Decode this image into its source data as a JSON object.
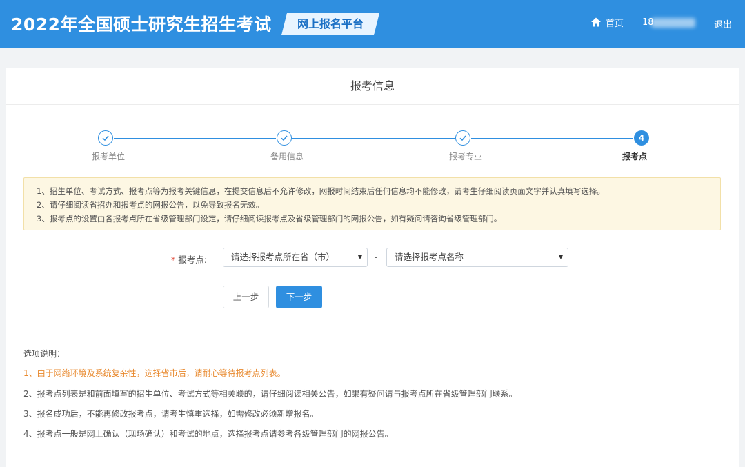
{
  "header": {
    "site_title": "2022年全国硕士研究生招生考试",
    "platform_label": "网上报名平台",
    "home_label": "首页",
    "user_id": "18",
    "logout_label": "退出",
    "brand_color": "#2f8fe0"
  },
  "panel": {
    "title": "报考信息"
  },
  "steps": [
    {
      "label": "报考单位",
      "state": "done",
      "icon": "check-icon"
    },
    {
      "label": "备用信息",
      "state": "done",
      "icon": "check-icon"
    },
    {
      "label": "报考专业",
      "state": "done",
      "icon": "check-icon"
    },
    {
      "label": "报考点",
      "state": "active",
      "number": "4"
    }
  ],
  "notice": {
    "lines": [
      "1、招生单位、考试方式、报考点等为报考关键信息，在提交信息后不允许修改，网报时间结束后任何信息均不能修改，请考生仔细阅读页面文字并认真填写选择。",
      "2、请仔细阅读省招办和报考点的网报公告，以免导致报名无效。",
      "3、报考点的设置由各报考点所在省级管理部门设定，请仔细阅读报考点及省级管理部门的网报公告，如有疑问请咨询省级管理部门。"
    ]
  },
  "form": {
    "required_mark": "*",
    "label": "报考点:",
    "province_select": "请选择报考点所在省（市）",
    "separator": "-",
    "site_select": "请选择报考点名称"
  },
  "buttons": {
    "prev": "上一步",
    "next": "下一步"
  },
  "description": {
    "title": "选项说明：",
    "lines": [
      "1、由于网络环境及系统复杂性，选择省市后，请耐心等待报考点列表。",
      "2、报考点列表是和前面填写的招生单位、考试方式等相关联的，请仔细阅读相关公告，如果有疑问请与报考点所在省级管理部门联系。",
      "3、报名成功后，不能再修改报考点，请考生慎重选择，如需修改必须新增报名。",
      "4、报考点一般是网上确认（现场确认）和考试的地点，选择报考点请参考各级管理部门的网报公告。"
    ],
    "warn_color": "#e8892e"
  }
}
